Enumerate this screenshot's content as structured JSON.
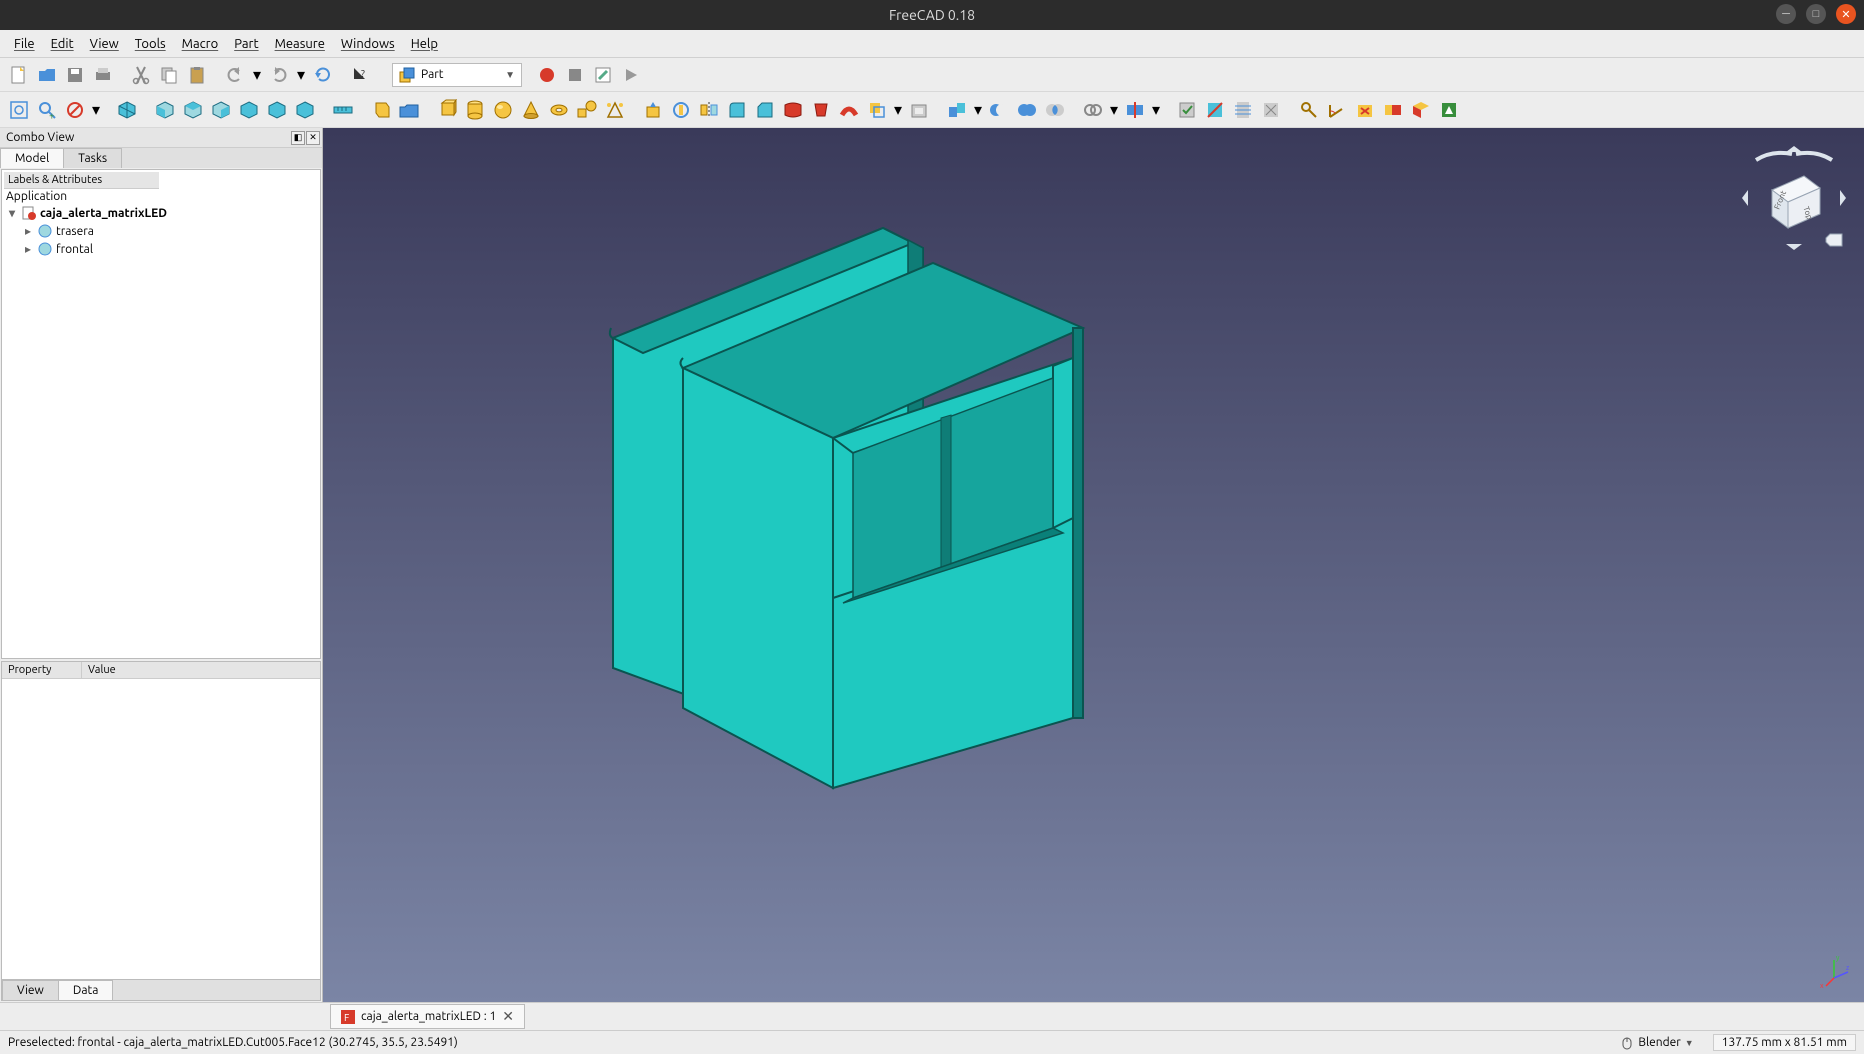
{
  "window": {
    "title": "FreeCAD 0.18"
  },
  "menu": {
    "file": "File",
    "edit": "Edit",
    "view": "View",
    "tools": "Tools",
    "macro": "Macro",
    "part": "Part",
    "measure": "Measure",
    "windows": "Windows",
    "help": "Help"
  },
  "workbench": {
    "label": "Part"
  },
  "combo_view": {
    "title": "Combo View",
    "tabs": {
      "model": "Model",
      "tasks": "Tasks"
    },
    "tree_header": "Labels & Attributes",
    "root": "Application",
    "doc": "caja_alerta_matrixLED",
    "items": [
      "trasera",
      "frontal"
    ]
  },
  "property": {
    "col1": "Property",
    "col2": "Value",
    "tabs": {
      "view": "View",
      "data": "Data"
    }
  },
  "doc_tab": {
    "label": "caja_alerta_matrixLED : 1"
  },
  "status": {
    "left": "Preselected: frontal - caja_alerta_matrixLED.Cut005.Face12 (30.2745, 35.5, 23.5491)",
    "nav_style": "Blender",
    "dims": "137.75 mm x 81.51 mm"
  },
  "navcube": {
    "face_top": "Top",
    "face_front": "Front"
  },
  "axes": {
    "x": "x",
    "y": "y",
    "z": "z"
  },
  "colors": {
    "model_face": "#1fc9c0",
    "model_top": "#16a59d",
    "model_edge": "#0a5550",
    "model_dark": "#0f7d77"
  }
}
